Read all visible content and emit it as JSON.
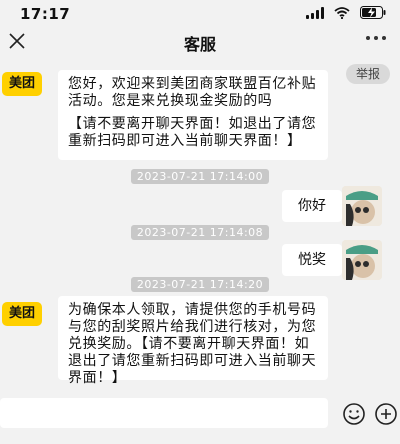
{
  "status_bar": {
    "time": "17:17"
  },
  "nav": {
    "title": "客服"
  },
  "report_label": "举报",
  "messages": [
    {
      "side": "left",
      "avatar_text": "美团",
      "paragraphs": [
        "您好，欢迎来到美团商家联盟百亿补贴活动。您是来兑换现金奖励的吗",
        "【请不要离开聊天界面！如退出了请您重新扫码即可进入当前聊天界面！】"
      ]
    },
    {
      "side": "center",
      "timestamp": "2023-07-21 17:14:00"
    },
    {
      "side": "right",
      "text": "你好"
    },
    {
      "side": "center",
      "timestamp": "2023-07-21 17:14:08"
    },
    {
      "side": "right",
      "text": "悦奖"
    },
    {
      "side": "center",
      "timestamp": "2023-07-21 17:14:20"
    },
    {
      "side": "left",
      "avatar_text": "美团",
      "paragraphs": [
        "为确保本人领取，请提供您的手机号码与您的刮奖照片给我们进行核对，为您兑换奖励。【请不要离开聊天界面！如退出了请您重新扫码即可进入当前聊天界面！】"
      ]
    }
  ],
  "input": {
    "value": "",
    "placeholder": ""
  },
  "icons": {
    "close": "close-icon",
    "more": "more-icon",
    "emoji": "emoji-icon",
    "add": "plus-circle-icon",
    "signal": "signal-icon",
    "wifi": "wifi-icon",
    "battery": "battery-charging-icon"
  }
}
